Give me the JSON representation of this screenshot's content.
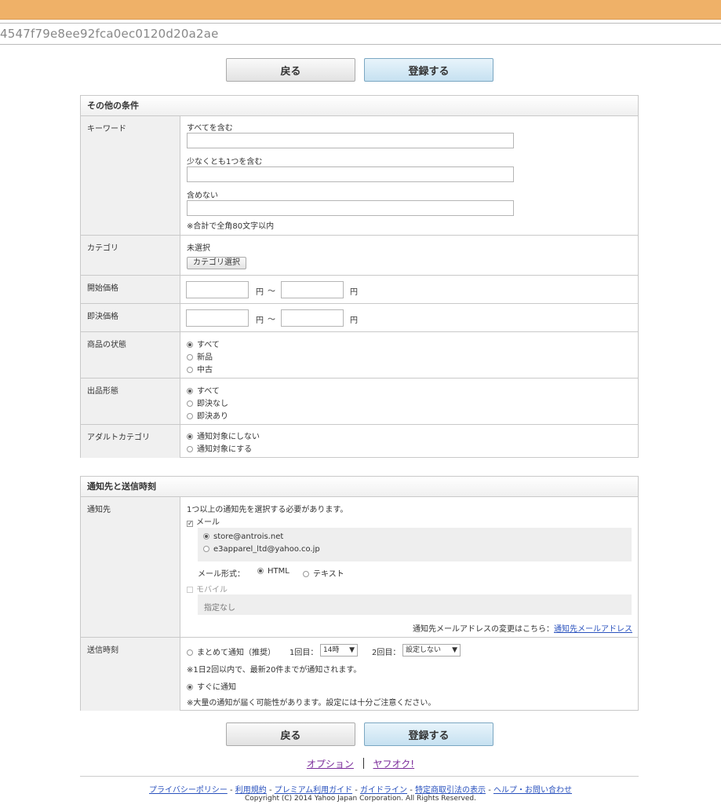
{
  "browser": {
    "url_fragment": "4547f79e8ee92fca0ec0120d20a2ae"
  },
  "buttons": {
    "back": "戻る",
    "register": "登録する"
  },
  "other_conditions": {
    "title": "その他の条件",
    "keyword": {
      "label": "キーワード",
      "all": "すべてを含む",
      "any": "少なくとも1つを含む",
      "none": "含めない",
      "note": "※合計で全角80文字以内"
    },
    "category": {
      "label": "カテゴリ",
      "value": "未選択",
      "select_button": "カテゴリ選択"
    },
    "start_price": {
      "label": "開始価格",
      "unit": "円",
      "tilde": "～"
    },
    "buyout_price": {
      "label": "即決価格",
      "unit": "円",
      "tilde": "～"
    },
    "condition": {
      "label": "商品の状態",
      "options": [
        "すべて",
        "新品",
        "中古"
      ],
      "selected": 0
    },
    "listing_type": {
      "label": "出品形態",
      "options": [
        "すべて",
        "即決なし",
        "即決あり"
      ],
      "selected": 0
    },
    "adult": {
      "label": "アダルトカテゴリ",
      "options": [
        "通知対象にしない",
        "通知対象にする"
      ],
      "selected": 0
    }
  },
  "notify": {
    "title": "通知先と送信時刻",
    "dest": {
      "label": "通知先",
      "required_note": "1つ以上の通知先を選択する必要があります。",
      "mail_label": "メール",
      "emails": [
        "store@antrois.net",
        "e3apparel_ltd@yahoo.co.jp"
      ],
      "email_selected": 0,
      "format_label": "メール形式：",
      "format_html": "HTML",
      "format_text": "テキスト",
      "mobile_label": "モバイル",
      "mobile_value": "指定なし",
      "change_note": "通知先メールアドレスの変更はこちら：",
      "change_link": "通知先メールアドレス"
    },
    "time": {
      "label": "送信時刻",
      "batch_label": "まとめて通知（推奨）",
      "first_label": "1回目：",
      "first_value": "14時",
      "second_label": "2回目：",
      "second_value": "設定しない",
      "batch_note": "※1日2回以内で、最新20件までが通知されます。",
      "instant_label": "すぐに通知",
      "instant_note": "※大量の通知が届く可能性があります。設定には十分ご注意ください。"
    }
  },
  "bottom_links": {
    "option": "オプション",
    "yafuoku": "ヤフオク!"
  },
  "footer": {
    "links": [
      "プライバシーポリシー",
      "利用規約",
      "プレミアム利用ガイド",
      "ガイドライン",
      "特定商取引法の表示",
      "ヘルプ・お問い合わせ"
    ],
    "separator": " - ",
    "copyright": "Copyright (C) 2014 Yahoo Japan Corporation. All Rights Reserved."
  }
}
